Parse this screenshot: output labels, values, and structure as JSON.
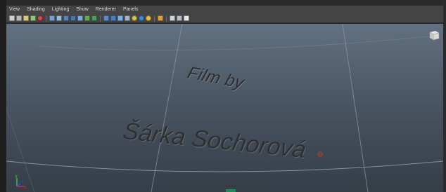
{
  "menubar": {
    "items": [
      "View",
      "Shading",
      "Lighting",
      "Show",
      "Renderer",
      "Panels"
    ]
  },
  "toolbar": {
    "icons": [
      "camera-select-icon",
      "camera-attributes-icon",
      "bookmark-icon",
      "image-plane-icon",
      "film-gate-icon",
      "sep",
      "grid-icon",
      "resolution-gate-icon",
      "gate-mask-icon",
      "field-chart-icon",
      "safe-action-icon",
      "safe-title-icon",
      "texture-icon",
      "sep",
      "wireframe-icon",
      "smooth-shade-icon",
      "flat-shade-icon",
      "bounding-box-icon",
      "default-light-icon",
      "shadow-icon",
      "ambient-occlusion-icon",
      "sep",
      "isolate-icon",
      "sep",
      "xray-icon",
      "xray-joints-icon",
      "shared-icon"
    ]
  },
  "viewport": {
    "title_line1": "Film by",
    "title_line2": "Šárka Sochorová",
    "axis_x": "x",
    "axis_y": "y",
    "axis_z": "z"
  },
  "colors": {
    "menubar_bg": "#444444",
    "viewport_top": "#627181",
    "viewport_bottom": "#353d47",
    "axis_x": "#e03030",
    "axis_y": "#40d040",
    "axis_z": "#3050ff",
    "pivot": "#b04020"
  }
}
